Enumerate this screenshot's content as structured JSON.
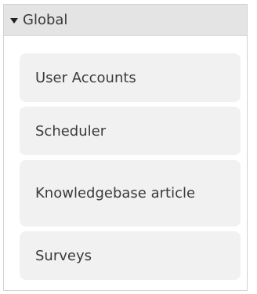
{
  "panel": {
    "title": "Global"
  },
  "items": [
    {
      "label": "User Accounts"
    },
    {
      "label": "Scheduler"
    },
    {
      "label": "Knowledgebase article"
    },
    {
      "label": "Surveys"
    }
  ]
}
